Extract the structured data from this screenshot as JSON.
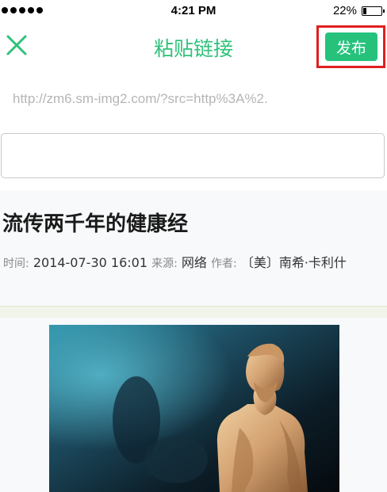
{
  "status_bar": {
    "time": "4:21 PM",
    "battery_percent": "22%",
    "battery_level": 0.22
  },
  "nav": {
    "title": "粘贴链接",
    "publish_label": "发布",
    "close_icon": "close-icon"
  },
  "url_line": "http://zm6.sm-img2.com/?src=http%3A%2.",
  "input": {
    "value": "",
    "placeholder": ""
  },
  "article": {
    "title": "流传两千年的健康经",
    "time_label": "时间:",
    "time_value": "2014-07-30 16:01",
    "source_label": "来源:",
    "source_value": "网络",
    "author_label": "作者:",
    "author_value": "〔美〕南希·卡利什"
  },
  "colors": {
    "accent": "#26c27c",
    "highlight": "#e21f1f"
  }
}
